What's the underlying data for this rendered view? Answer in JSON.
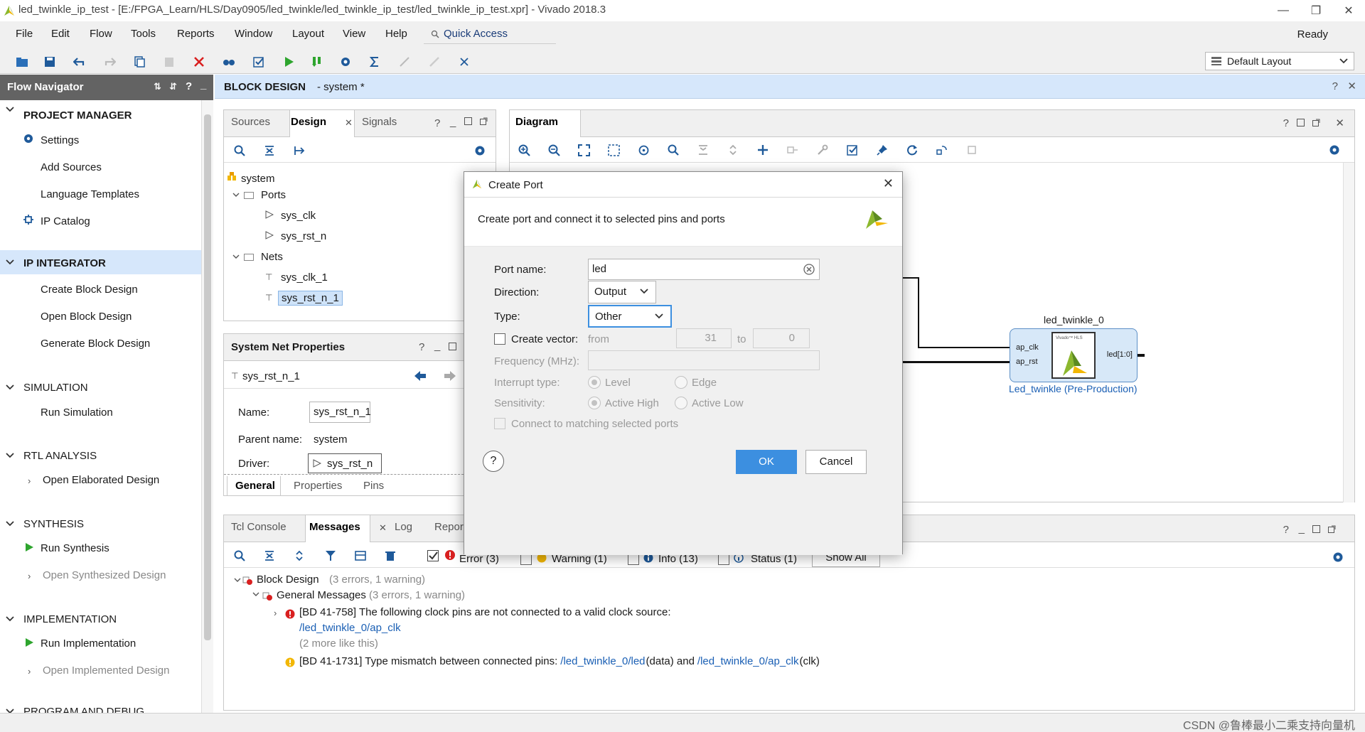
{
  "window": {
    "title": "led_twinkle_ip_test - [E:/FPGA_Learn/HLS/Day0905/led_twinkle/led_twinkle_ip_test/led_twinkle_ip_test.xpr] - Vivado 2018.3"
  },
  "menu": {
    "items": [
      {
        "label": "File"
      },
      {
        "label": "Edit"
      },
      {
        "label": "Flow"
      },
      {
        "label": "Tools"
      },
      {
        "label": "Reports"
      },
      {
        "label": "Window"
      },
      {
        "label": "Layout"
      },
      {
        "label": "View"
      },
      {
        "label": "Help"
      }
    ],
    "quick_access": "Quick Access",
    "status": "Ready"
  },
  "toolbar": {
    "layout_select": "Default Layout"
  },
  "flow_navigator": {
    "title": "Flow Navigator",
    "sections": [
      {
        "title": "PROJECT MANAGER",
        "items": [
          "Settings",
          "Add Sources",
          "Language Templates",
          "IP Catalog"
        ]
      },
      {
        "title": "IP INTEGRATOR",
        "items": [
          "Create Block Design",
          "Open Block Design",
          "Generate Block Design"
        ]
      },
      {
        "title": "SIMULATION",
        "items": [
          "Run Simulation"
        ]
      },
      {
        "title": "RTL ANALYSIS",
        "items": [
          "Open Elaborated Design"
        ]
      },
      {
        "title": "SYNTHESIS",
        "items": [
          "Run Synthesis",
          "Open Synthesized Design"
        ]
      },
      {
        "title": "IMPLEMENTATION",
        "items": [
          "Run Implementation",
          "Open Implemented Design"
        ]
      },
      {
        "title": "PROGRAM AND DEBUG",
        "items": []
      }
    ]
  },
  "block_design": {
    "title": "BLOCK DESIGN",
    "subtitle": "- system *"
  },
  "sources_panel": {
    "tabs": [
      "Sources",
      "Design",
      "Signals"
    ],
    "tree": {
      "root": "system",
      "ports_label": "Ports",
      "ports": [
        "sys_clk",
        "sys_rst_n"
      ],
      "nets_label": "Nets",
      "nets": [
        "sys_clk_1",
        "sys_rst_n_1"
      ]
    }
  },
  "net_props": {
    "title": "System Net Properties",
    "net": "sys_rst_n_1",
    "name_label": "Name:",
    "name_value": "sys_rst_n_1",
    "parent_label": "Parent name:",
    "parent_value": "system",
    "driver_label": "Driver:",
    "driver_value": "sys_rst_n",
    "tabs": [
      "General",
      "Properties",
      "Pins"
    ]
  },
  "diagram": {
    "title": "Diagram",
    "block": {
      "instance": "led_twinkle_0",
      "pin_clk": "ap_clk",
      "pin_rst": "ap_rst",
      "pin_out": "led[1:0]",
      "logo_text": "Vivado™ HLS",
      "caption": "Led_twinkle (Pre-Production)"
    }
  },
  "dialog": {
    "title": "Create Port",
    "description": "Create port and connect it to selected pins and ports",
    "port_name_label": "Port name:",
    "port_name_value": "led",
    "direction_label": "Direction:",
    "direction_value": "Output",
    "type_label": "Type:",
    "type_value": "Other",
    "create_vector_label": "Create vector:",
    "from_label": "from",
    "from_value": "31",
    "to_label": "to",
    "to_value": "0",
    "frequency_label": "Frequency (MHz):",
    "interrupt_label": "Interrupt type:",
    "interrupt_level": "Level",
    "interrupt_edge": "Edge",
    "sensitivity_label": "Sensitivity:",
    "sens_high": "Active High",
    "sens_low": "Active Low",
    "connect_label": "Connect to matching selected ports",
    "ok": "OK",
    "cancel": "Cancel",
    "help": "?"
  },
  "messages": {
    "tabs": [
      "Tcl Console",
      "Messages",
      "Log",
      "Repor"
    ],
    "filters": {
      "error": "Error (3)",
      "warning": "Warning (1)",
      "info": "Info (13)",
      "status": "Status (1)",
      "show_all": "Show All"
    },
    "block_design": "Block Design",
    "block_design_count": "(3 errors, 1 warning)",
    "general": "General Messages",
    "general_count": "(3 errors, 1 warning)",
    "error_text": "[BD 41-758] The following clock pins are not connected to a valid clock source:",
    "error_link": "/led_twinkle_0/ap_clk",
    "more": "(2 more like this)",
    "warn_prefix": "[BD 41-1731] Type mismatch between connected pins:",
    "warn_link1": "/led_twinkle_0/led",
    "warn_mid": "(data) and",
    "warn_link2": "/led_twinkle_0/ap_clk",
    "warn_end": "(clk)"
  },
  "watermark": "CSDN @鲁棒最小二乘支持向量机",
  "colors": {
    "accent": "#3c8fe0",
    "nav_header": "#636363",
    "selected_bg": "#d6e7fb",
    "error": "#d92020",
    "warning": "#f2b705",
    "xilinx_green": "#8cb82e",
    "link": "#1a5fb4"
  }
}
